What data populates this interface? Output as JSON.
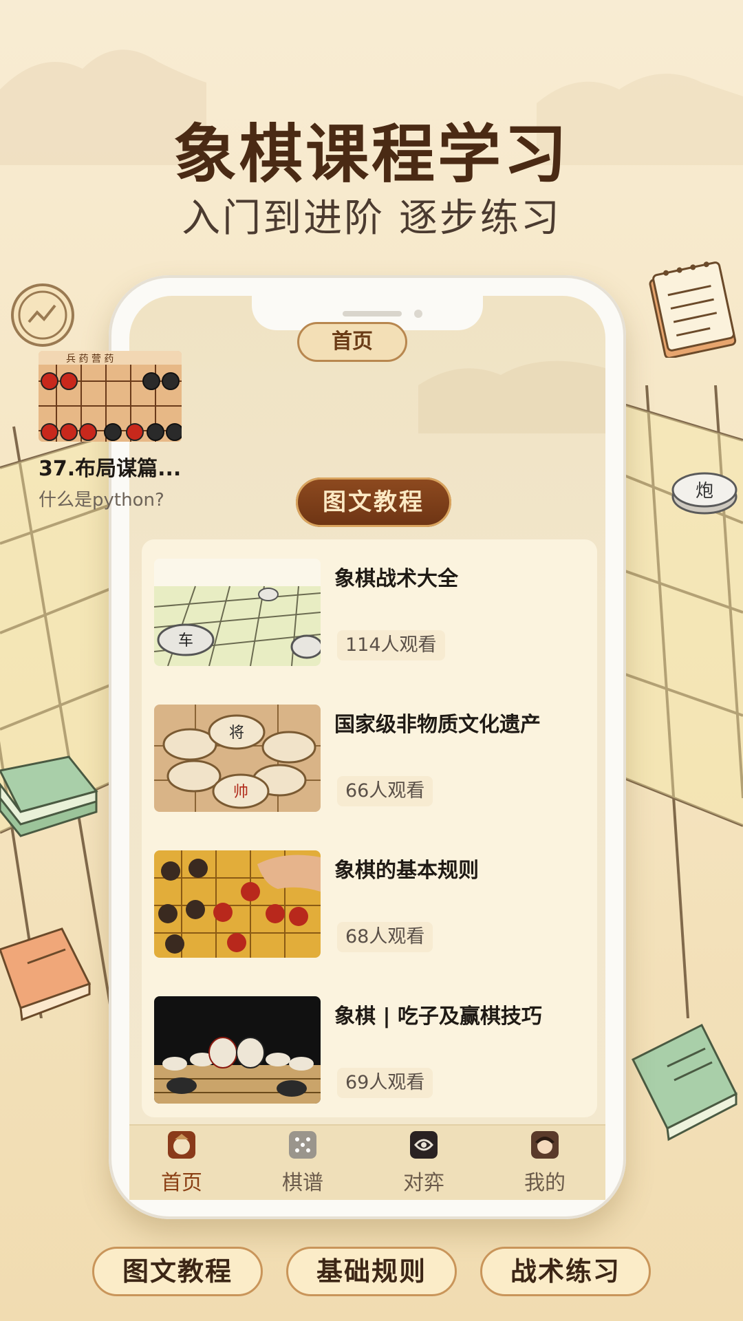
{
  "hero": {
    "title": "象棋课程学习",
    "subtitle": "入门到进阶 逐步练习"
  },
  "app": {
    "top_tab": "首页",
    "featured": {
      "title": "37.布局谋篇...",
      "subtitle": "什么是python?"
    },
    "section_title": "图文教程",
    "courses": [
      {
        "title": "象棋战术大全",
        "views": "114人观看",
        "thumb": "board-perspective"
      },
      {
        "title": "国家级非物质文化遗产",
        "views": "66人观看",
        "thumb": "pieces-closeup"
      },
      {
        "title": "象棋的基本规则",
        "views": "68人观看",
        "thumb": "hand-moving-piece"
      },
      {
        "title": "象棋 | 吃子及赢棋技巧",
        "views": "69人观看",
        "thumb": "pieces-dark"
      }
    ],
    "tabbar": [
      {
        "label": "首页",
        "icon": "home-icon",
        "active": true
      },
      {
        "label": "棋谱",
        "icon": "dice-icon",
        "active": false
      },
      {
        "label": "对弈",
        "icon": "swirl-icon",
        "active": false
      },
      {
        "label": "我的",
        "icon": "avatar-icon",
        "active": false
      }
    ]
  },
  "pills": [
    "图文教程",
    "基础规则",
    "战术练习"
  ],
  "colors": {
    "brand_brown": "#6d3414",
    "accent_gold": "#c9955a",
    "background": "#f6e7c6"
  }
}
